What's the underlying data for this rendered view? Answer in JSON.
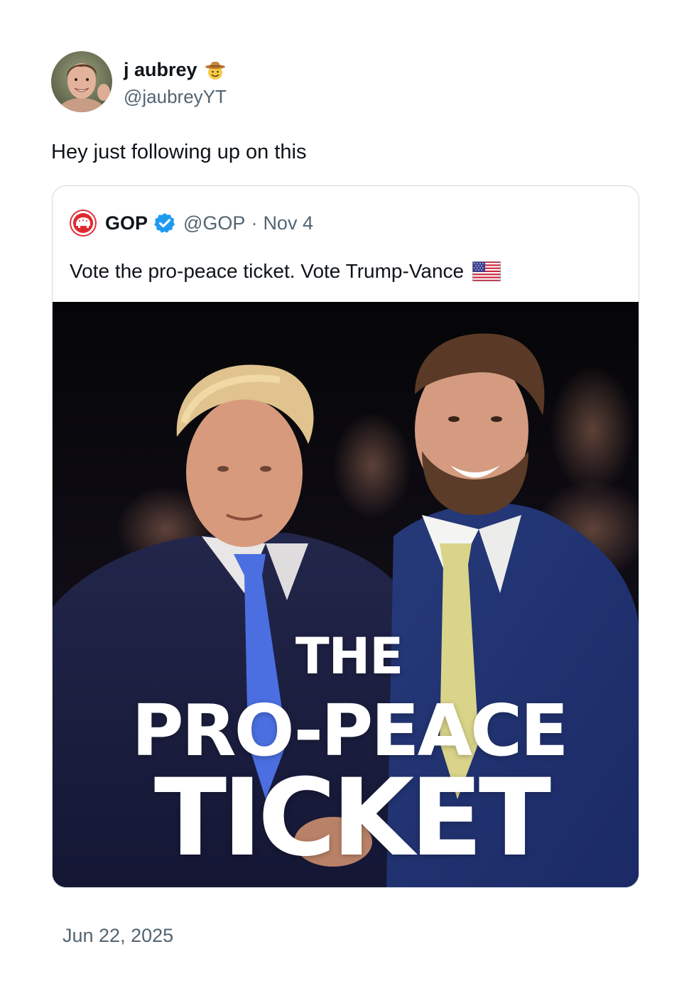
{
  "author": {
    "display_name": "j aubrey",
    "badge_emoji": "cowboy-hat-face",
    "handle": "@jaubreyYT"
  },
  "tweet": {
    "text": "Hey just following up on this",
    "timestamp": "Jun 22, 2025"
  },
  "quoted": {
    "display_name": "GOP",
    "verified": true,
    "handle": "@GOP",
    "separator": "·",
    "date": "Nov 4",
    "text": "Vote the pro-peace ticket. Vote Trump-Vance",
    "text_emoji": "us-flag",
    "image": {
      "line1": "THE",
      "line2": "PRO-PEACE",
      "line3": "TICKET"
    }
  },
  "colors": {
    "text_primary": "#0f1419",
    "text_secondary": "#536471",
    "border": "#cfd9de",
    "verified_blue": "#1d9bf0",
    "gop_red": "#e0282e"
  }
}
